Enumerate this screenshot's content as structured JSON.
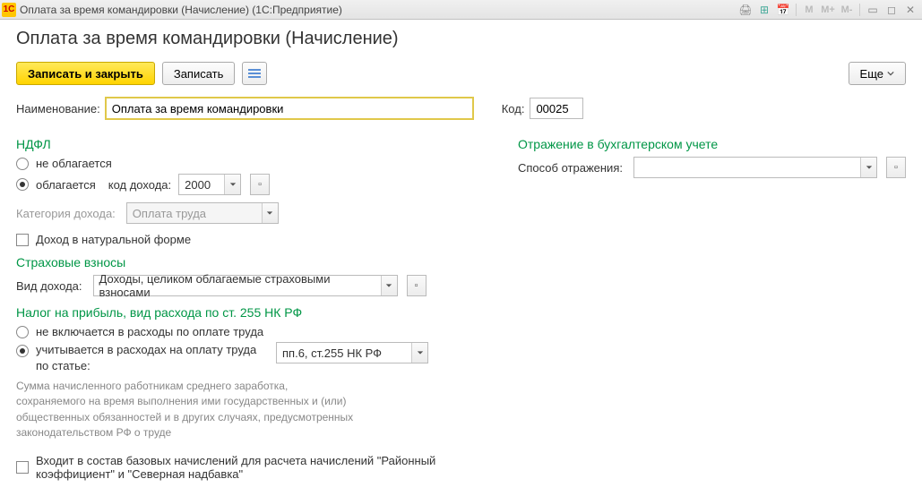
{
  "window": {
    "title": "Оплата за время командировки (Начисление)  (1С:Предприятие)",
    "logo_text": "1C"
  },
  "header": "Оплата за время командировки (Начисление)",
  "toolbar": {
    "save_close": "Записать и закрыть",
    "save": "Записать",
    "more": "Еще"
  },
  "fields": {
    "name_label": "Наименование:",
    "name_value": "Оплата за время командировки",
    "code_label": "Код:",
    "code_value": "00025"
  },
  "ndfl": {
    "title": "НДФЛ",
    "not_taxed": "не облагается",
    "taxed": "облагается",
    "income_code_label": "код дохода:",
    "income_code_value": "2000",
    "category_label": "Категория дохода:",
    "category_value": "Оплата труда",
    "natural_form": "Доход в натуральной форме"
  },
  "insurance": {
    "title": "Страховые взносы",
    "kind_label": "Вид дохода:",
    "kind_value": "Доходы, целиком облагаемые страховыми взносами"
  },
  "profit_tax": {
    "title": "Налог на прибыль, вид расхода по ст. 255 НК РФ",
    "not_included": "не включается в расходы по оплате труда",
    "included": "учитывается в расходах на оплату труда по статье:",
    "article_value": "пп.6, ст.255 НК РФ",
    "help": "Сумма начисленного работникам среднего заработка, сохраняемого на время выполнения ими государственных и (или) общественных обязанностей и в других случаях, предусмотренных законодательством РФ о труде"
  },
  "base_included": "Входит в состав базовых начислений для расчета начислений \"Районный коэффициент\" и \"Северная надбавка\"",
  "accounting": {
    "title": "Отражение в бухгалтерском учете",
    "method_label": "Способ отражения:",
    "method_value": ""
  }
}
